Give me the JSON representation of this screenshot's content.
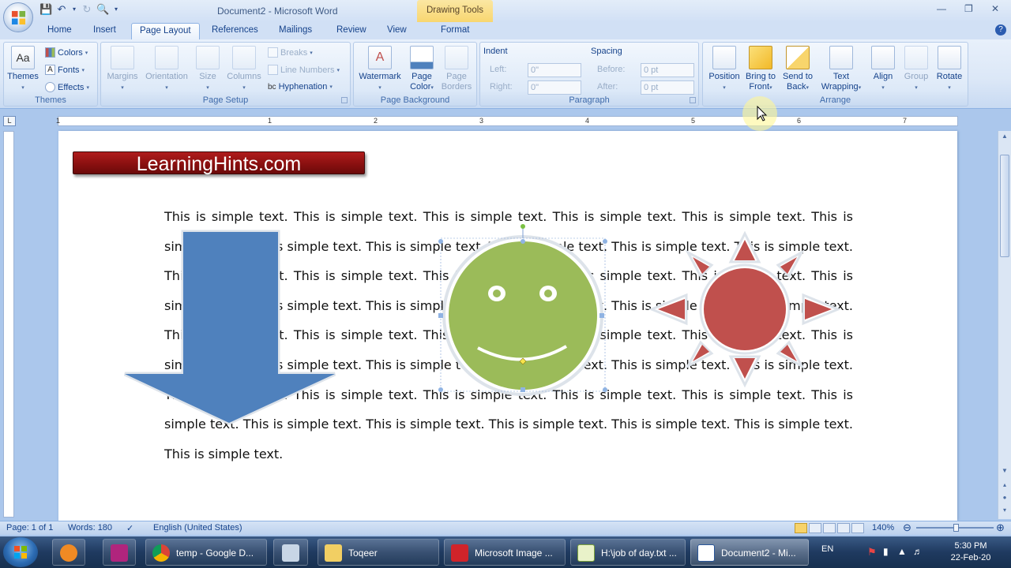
{
  "window": {
    "title": "Document2 - Microsoft Word",
    "context_tab": "Drawing Tools"
  },
  "tabs": [
    {
      "label": "Home",
      "active": false
    },
    {
      "label": "Insert",
      "active": false
    },
    {
      "label": "Page Layout",
      "active": true
    },
    {
      "label": "References",
      "active": false
    },
    {
      "label": "Mailings",
      "active": false
    },
    {
      "label": "Review",
      "active": false
    },
    {
      "label": "View",
      "active": false
    },
    {
      "label": "Format",
      "active": false
    }
  ],
  "ribbon": {
    "themes": {
      "label": "Themes",
      "themes_btn": "Themes",
      "colors": "Colors",
      "fonts": "Fonts",
      "effects": "Effects"
    },
    "page_setup": {
      "label": "Page Setup",
      "margins": "Margins",
      "orientation": "Orientation",
      "size": "Size",
      "columns": "Columns",
      "breaks": "Breaks",
      "line_numbers": "Line Numbers",
      "hyphenation": "Hyphenation"
    },
    "page_background": {
      "label": "Page Background",
      "watermark": "Watermark",
      "page_color": "Page Color",
      "page_color_line1": "Page",
      "page_color_line2": "Color",
      "page_borders_line1": "Page",
      "page_borders_line2": "Borders"
    },
    "paragraph": {
      "label": "Paragraph",
      "indent_title": "Indent",
      "left_label": "Left:",
      "left_value": "0\"",
      "right_label": "Right:",
      "right_value": "0\"",
      "spacing_title": "Spacing",
      "before_label": "Before:",
      "before_value": "0 pt",
      "after_label": "After:",
      "after_value": "0 pt"
    },
    "arrange": {
      "label": "Arrange",
      "position": "Position",
      "bring_front_line1": "Bring to",
      "bring_front_line2": "Front",
      "send_back_line1": "Send to",
      "send_back_line2": "Back",
      "text_wrapping_line1": "Text",
      "text_wrapping_line2": "Wrapping",
      "align": "Align",
      "group": "Group",
      "rotate": "Rotate"
    }
  },
  "document": {
    "banner_text": "LearningHints.com",
    "body_text": "This is simple text. This is simple text. This is simple text. This is simple text. This is simple text. This is simple text. This is simple text. This is simple text. This is simple text. This is simple text. This is simple text. This is simple text. This is simple text. This is simple text. This is simple text. This is simple text. This is simple text. This is simple text. This is simple text. This is simple text. This is simple text. This is simple text. This is simple text. This is simple text. This is simple text. This is simple text. This is simple text. This is simple text. This is simple text. This is simple text. This is simple text. This is simple text. This is simple text. This is simple text. This is simple text. This is simple text. This is simple text. This is simple text. This is simple text. This is simple text. This is simple text. This is simple text. This is simple text. This is simple text. This is simple text."
  },
  "colors": {
    "arrow": "#4f81bd",
    "smiley": "#9bbb59",
    "sun": "#c0504d",
    "banner": "#9b1515"
  },
  "ruler": {
    "numbers": [
      "1",
      "1",
      "2",
      "3",
      "4",
      "5",
      "6",
      "7"
    ]
  },
  "status": {
    "page": "Page: 1 of 1",
    "words": "Words: 180",
    "language": "English (United States)",
    "zoom": "140%"
  },
  "taskbar": {
    "items": [
      {
        "label": "temp - Google D...",
        "icon": "chrome-icon"
      },
      {
        "label": "Toqeer",
        "icon": "folder-icon"
      },
      {
        "label": "Microsoft Image ...",
        "icon": "image-composer-icon"
      },
      {
        "label": "H:\\job of day.txt ...",
        "icon": "notepad-icon"
      },
      {
        "label": "Document2 - Mi...",
        "icon": "word-icon"
      }
    ],
    "language": "EN",
    "time": "5:30 PM",
    "date": "22-Feb-20"
  }
}
